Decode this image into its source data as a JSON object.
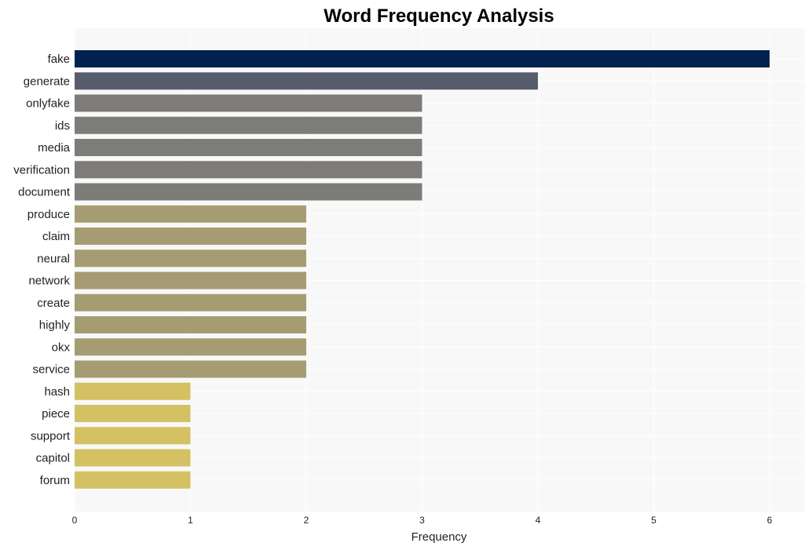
{
  "chart_data": {
    "type": "bar",
    "orientation": "horizontal",
    "title": "Word Frequency Analysis",
    "xlabel": "Frequency",
    "ylabel": "",
    "xlim": [
      0,
      6.3
    ],
    "xticks": [
      0,
      1,
      2,
      3,
      4,
      5,
      6
    ],
    "grid": true,
    "categories": [
      "fake",
      "generate",
      "onlyfake",
      "ids",
      "media",
      "verification",
      "document",
      "produce",
      "claim",
      "neural",
      "network",
      "create",
      "highly",
      "okx",
      "service",
      "hash",
      "piece",
      "support",
      "capitol",
      "forum"
    ],
    "values": [
      6,
      4,
      3,
      3,
      3,
      3,
      3,
      2,
      2,
      2,
      2,
      2,
      2,
      2,
      2,
      1,
      1,
      1,
      1,
      1
    ],
    "colors": {
      "6": "#00224e",
      "4": "#575d6d",
      "3": "#7d7c78",
      "2": "#a59c74",
      "1": "#d3c164"
    },
    "background": "#f8f8f8"
  }
}
